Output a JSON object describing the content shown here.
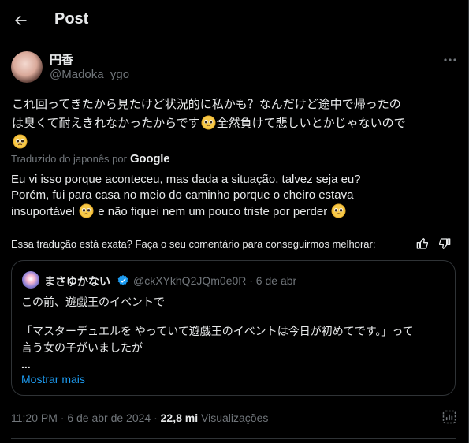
{
  "header": {
    "title": "Post"
  },
  "author": {
    "display_name": "円香",
    "handle": "@Madoka_ygo"
  },
  "tweet": {
    "line1": "これ回ってきたから見たけど状況的に私かも？なんだけど途中で帰ったの",
    "line2a": "は臭くて耐えきれなかったからです",
    "line2b": "全然負けて悲しいとかじゃないので"
  },
  "translation": {
    "label": "Traduzido do japonês por",
    "provider": "Google",
    "line1": "Eu vi isso porque aconteceu, mas dada a situação, talvez seja eu?",
    "line2": "Porém, fui para casa no meio do caminho porque o cheiro estava",
    "line3a": "insuportável",
    "line3b": "e não fiquei nem um pouco triste por perder"
  },
  "feedback": {
    "text": "Essa tradução está exata? Faça o seu comentário para conseguirmos melhorar:"
  },
  "quote": {
    "name": "まさゆかない",
    "handle_date": "@ckXYkhQ2JQm0e0R · 6 de abr",
    "line1": "この前、遊戯王のイベントで",
    "line2": "「マスターデュエルを やっていて遊戯王のイベントは今日が初めてです。」って",
    "line3": "言う女の子がいましたが",
    "ellipsis": "...",
    "show_more": "Mostrar mais"
  },
  "footer": {
    "time_date": "11:20 PM · 6 de abr de 2024 · ",
    "views_count": "22,8 mi",
    "views_label": " Visualizações"
  },
  "colors": {
    "background": "#000000",
    "text": "#e7e9ea",
    "muted": "#71767b",
    "link": "#1d9bf0",
    "border": "#2f3336"
  },
  "icons": [
    "back-arrow-icon",
    "more-icon",
    "pleading-face-emoji",
    "google-logo",
    "thumbs-up-icon",
    "thumbs-down-icon",
    "verified-badge-icon",
    "post-stats-icon"
  ]
}
